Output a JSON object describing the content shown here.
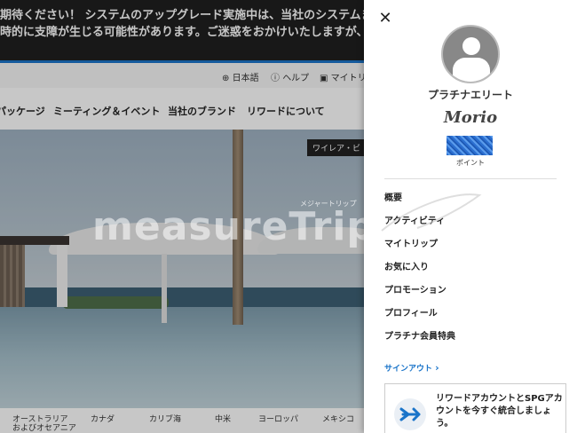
{
  "notice": {
    "line1": "期待ください！ システムのアップグレード実施中は、当社のシステムま",
    "line2": "時的に支障が生じる可能性があります。ご迷惑をおかけいたしますが、"
  },
  "utility": {
    "language": "日本語",
    "help": "ヘルプ",
    "trips": "マイトリ"
  },
  "nav": {
    "items": [
      "パッケージ",
      "ミーティング＆イベント",
      "当社のブランド",
      "リワードについて"
    ]
  },
  "hero": {
    "tag": "ワイレア・ビ"
  },
  "regions": {
    "items": [
      "オーストラリア",
      "およびオセアニア",
      "カナダ",
      "カリブ海",
      "中米",
      "ヨーロッパ",
      "メキシコ"
    ]
  },
  "watermark": {
    "text": "measureTrip.com",
    "small": "メジャートリップ"
  },
  "panel": {
    "close_glyph": "✕",
    "tier": "プラチナエリート",
    "signature": "Morio",
    "points_label": "ポイント",
    "menu": [
      "概要",
      "アクティビティ",
      "マイトリップ",
      "お気に入り",
      "プロモーション",
      "プロフィール",
      "プラチナ会員特典"
    ],
    "signout": "サインアウト",
    "signout_chevron": "›",
    "promo_text": "リワードアカウントとSPGアカウントを今すぐ統合しましょう。"
  },
  "colors": {
    "accent": "#1a74c9",
    "notice_bg": "#1f1f1f"
  }
}
